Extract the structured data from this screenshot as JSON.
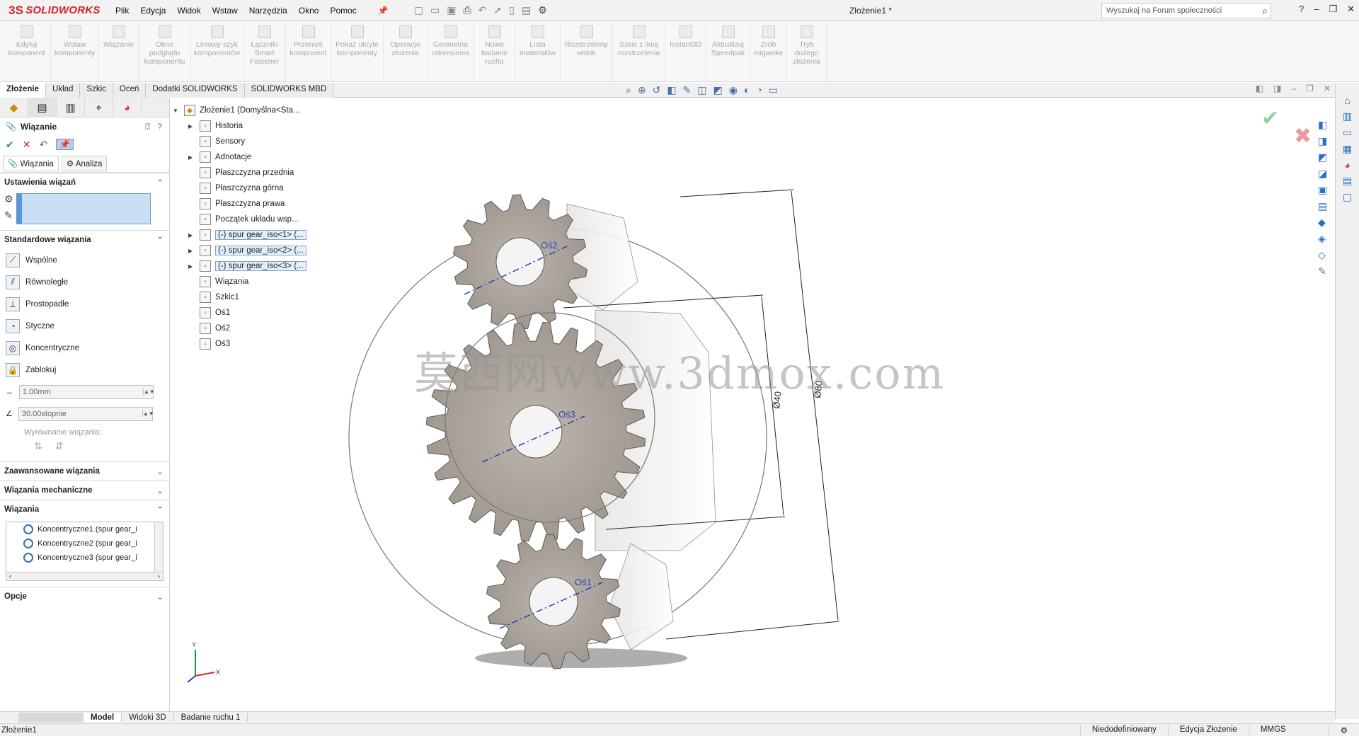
{
  "app": {
    "logo_text": "SOLIDWORKS",
    "logo_prefix": "3S",
    "document_title": "Złożenie1 *",
    "search_placeholder": "Wyszukaj na Forum społeczności",
    "brand_color": "#d4232d"
  },
  "menu": [
    "Plik",
    "Edycja",
    "Widok",
    "Wstaw",
    "Narzędzia",
    "Okno",
    "Pomoc"
  ],
  "commands": [
    {
      "label": "Edytuj komponent"
    },
    {
      "label": "Wstaw komponenty"
    },
    {
      "label": "Wiązanie"
    },
    {
      "label": "Okno podglądu komponentu"
    },
    {
      "label": "Liniowy szyk komponentów"
    },
    {
      "label": "Łączniki Smart Fastener"
    },
    {
      "label": "Przenieś komponent"
    },
    {
      "label": "Pokaż ukryte komponenty"
    },
    {
      "label": "Operacje złożenia"
    },
    {
      "label": "Geometria odniesienia"
    },
    {
      "label": "Nowe badanie ruchu"
    },
    {
      "label": "Lista materiałów"
    },
    {
      "label": "Rozstrzelony widok"
    },
    {
      "label": "Szkic z linią rozstrzelenia"
    },
    {
      "label": "Instant3D"
    },
    {
      "label": "Aktualizuj Speedpak"
    },
    {
      "label": "Zrób migawkę"
    },
    {
      "label": "Tryb dużego złożenia"
    }
  ],
  "tabs": [
    "Złożenie",
    "Układ",
    "Szkic",
    "Oceń",
    "Dodatki SOLIDWORKS",
    "SOLIDWORKS MBD"
  ],
  "property_manager": {
    "title": "Wiązanie",
    "subtabs": [
      "Wiązania",
      "Analiza"
    ],
    "sections": {
      "mate_settings": "Ustawienia wiązań",
      "standard_mates": "Standardowe wiązania",
      "advanced": "Zaawansowane wiązania",
      "mechanical": "Wiązania mechaniczne",
      "mates": "Wiązania",
      "options": "Opcje"
    },
    "standard_mate_items": [
      "Wspólne",
      "Równoległe",
      "Prostopadłe",
      "Styczne",
      "Koncentryczne",
      "Zablokuj"
    ],
    "distance_value": "1.00mm",
    "angle_value": "30.00stopnie",
    "alignment_label": "Wyrównanie wiązania:",
    "mates_list": [
      "Koncentryczne1 (spur gear_i",
      "Koncentryczne2 (spur gear_i",
      "Koncentryczne3 (spur gear_i"
    ]
  },
  "tree": {
    "root": "Złożenie1  (Domyślna<Sta...",
    "items": [
      {
        "label": "Historia",
        "expandable": true,
        "selected": false
      },
      {
        "label": "Sensory",
        "expandable": false,
        "selected": false
      },
      {
        "label": "Adnotacje",
        "expandable": true,
        "selected": false
      },
      {
        "label": "Płaszczyzna przednia",
        "expandable": false,
        "selected": false
      },
      {
        "label": "Płaszczyzna górna",
        "expandable": false,
        "selected": false
      },
      {
        "label": "Płaszczyzna prawa",
        "expandable": false,
        "selected": false
      },
      {
        "label": "Początek układu wsp...",
        "expandable": false,
        "selected": false
      },
      {
        "label": "(-) spur gear_iso<1> (...",
        "expandable": true,
        "selected": true
      },
      {
        "label": "(-) spur gear_iso<2> (...",
        "expandable": true,
        "selected": true
      },
      {
        "label": "(-) spur gear_iso<3> (...",
        "expandable": true,
        "selected": true
      },
      {
        "label": "Wiązania",
        "expandable": false,
        "selected": false
      },
      {
        "label": "Szkic1",
        "expandable": false,
        "selected": false
      },
      {
        "label": "Oś1",
        "expandable": false,
        "selected": false
      },
      {
        "label": "Oś2",
        "expandable": false,
        "selected": false
      },
      {
        "label": "Oś3",
        "expandable": false,
        "selected": false
      }
    ]
  },
  "viewport": {
    "axis_labels": [
      "Oś2",
      "Oś3",
      "Oś1"
    ],
    "dimensions": [
      "Ø40",
      "Ø80"
    ],
    "triad": {
      "x": "X",
      "y": "Y"
    },
    "watermark": "莫西网www.3dmox.com"
  },
  "bottom_tabs": [
    "Model",
    "Widoki 3D",
    "Badanie ruchu 1"
  ],
  "status": {
    "left": "Złożenie1",
    "state": "Niedodefiniowany",
    "mode": "Edycja Złożenie",
    "units": "MMGS"
  }
}
